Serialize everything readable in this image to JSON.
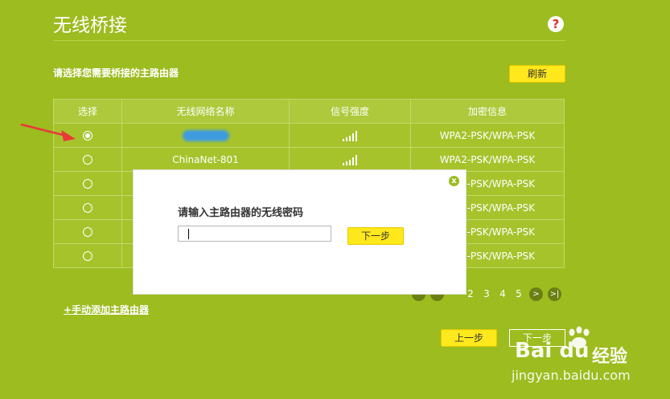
{
  "header": {
    "title": "无线桥接",
    "help_icon": "?"
  },
  "section": {
    "subtitle": "请选择您需要桥接的主路由器",
    "refresh_label": "刷新"
  },
  "table": {
    "headers": [
      "选择",
      "无线网络名称",
      "信号强度",
      "加密信息"
    ],
    "rows": [
      {
        "selected": true,
        "ssid": "",
        "ssid_hidden": true,
        "signal_bars": 5,
        "security": "WPA2-PSK/WPA-PSK"
      },
      {
        "selected": false,
        "ssid": "ChinaNet-801",
        "signal_bars": 5,
        "security": "WPA2-PSK/WPA-PSK"
      },
      {
        "selected": false,
        "ssid": "",
        "signal_bars": 0,
        "security": "-PSK/WPA-PSK"
      },
      {
        "selected": false,
        "ssid": "",
        "signal_bars": 0,
        "security": "-PSK/WPA-PSK"
      },
      {
        "selected": false,
        "ssid": "",
        "signal_bars": 0,
        "security": "-PSK/WPA-PSK"
      },
      {
        "selected": false,
        "ssid": "",
        "signal_bars": 0,
        "security": "-PSK/WPA-PSK"
      }
    ]
  },
  "pagination": {
    "pages": [
      "2",
      "3",
      "4",
      "5"
    ],
    "next_icon": ">",
    "last_icon": ">|"
  },
  "links": {
    "manual_add": "+手动添加主路由器"
  },
  "footer": {
    "back_label": "上一步",
    "next_label": "下一步"
  },
  "watermark": {
    "logo": "Bai du",
    "cn": "经验",
    "url": "jingyan.baidu.com"
  },
  "modal": {
    "label": "请输入主路由器的无线密码",
    "input_value": "",
    "next_label": "下一步",
    "close_icon": "x"
  },
  "colors": {
    "background": "#9cbc1f",
    "button": "#ffe81c",
    "arrow": "#e8393b",
    "blur": "#3f9be0"
  }
}
